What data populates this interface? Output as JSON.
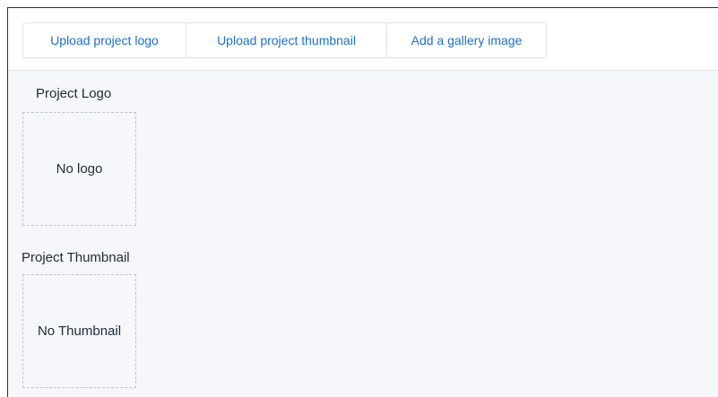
{
  "toolbar": {
    "upload_logo_label": "Upload project logo",
    "upload_thumbnail_label": "Upload project thumbnail",
    "add_gallery_label": "Add a gallery image"
  },
  "logo_section": {
    "title": "Project Logo",
    "empty_text": "No logo"
  },
  "thumbnail_section": {
    "title": "Project Thumbnail",
    "empty_text": "No Thumbnail"
  },
  "colors": {
    "link_blue": "#1b6fc9",
    "text_dark": "#1d2a3a",
    "panel_bg": "#f5f7fa"
  }
}
